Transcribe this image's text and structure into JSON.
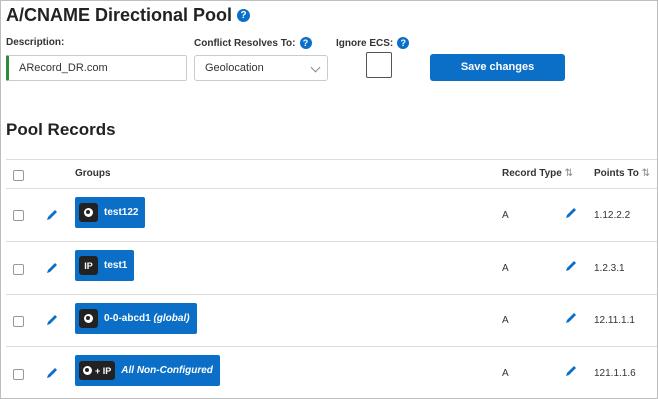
{
  "header": {
    "title": "A/CNAME Directional Pool",
    "help_icon": "?"
  },
  "form": {
    "description_label": "Description:",
    "description_value": "ARecord_DR.com",
    "conflict_label": "Conflict Resolves To:",
    "conflict_value": "Geolocation",
    "ignore_ecs_label": "Ignore ECS:",
    "ignore_ecs_checked": false,
    "save_label": "Save changes"
  },
  "pool": {
    "title": "Pool Records",
    "columns": {
      "groups": "Groups",
      "record_type": "Record Type",
      "points_to": "Points To",
      "sort_icon": "⇅"
    },
    "rows": [
      {
        "icon_type": "globe",
        "icon_text": "",
        "name": "test122",
        "suffix": "",
        "record_type": "A",
        "points_to": "1.12.2.2"
      },
      {
        "icon_type": "ip",
        "icon_text": "IP",
        "name": "test1",
        "suffix": "",
        "record_type": "A",
        "points_to": "1.2.3.1"
      },
      {
        "icon_type": "globe",
        "icon_text": "",
        "name": "0-0-abcd1",
        "suffix": "(global)",
        "record_type": "A",
        "points_to": "12.11.1.1"
      },
      {
        "icon_type": "globe-ip",
        "icon_text": "+ IP",
        "name": "All Non-Configured",
        "suffix": "",
        "record_type": "A",
        "points_to": "121.1.1.6"
      }
    ]
  },
  "colors": {
    "primary": "#0b6fc7",
    "accent_green": "#2e8b3a",
    "dark_badge": "#222222"
  }
}
